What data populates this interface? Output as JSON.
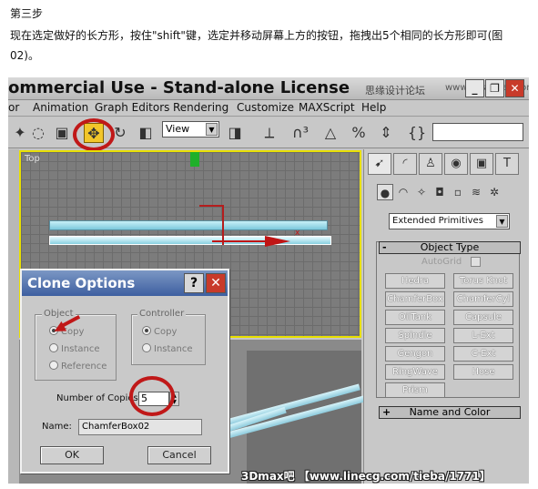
{
  "tutorial": {
    "step": "第三步",
    "description": "现在选定做好的长方形，按住\"shift\"键，选定并移动屏幕上方的按钮，拖拽出5个相同的长方形即可(图02)。"
  },
  "window": {
    "title": "ommercial Use - Stand-alone License",
    "watermark": "思缘设计论坛",
    "watermark_url": "www.missyuan.com",
    "minimize": "_",
    "maximize": "❐",
    "close": "✕"
  },
  "menu": [
    "or",
    "Animation",
    "Graph Editors",
    "Rendering",
    "Customize",
    "MAXScript",
    "Help"
  ],
  "toolbar": {
    "view_select": "View"
  },
  "viewport": {
    "label": "Top"
  },
  "command_panel": {
    "primitive_type": "Extended Primitives",
    "object_type_header": "Object Type",
    "autogrid_label": "AutoGrid",
    "buttons": [
      "Hedra",
      "Torus Knot",
      "ChamferBox",
      "ChamferCyl",
      "OilTank",
      "Capsule",
      "Spindle",
      "L-Ext",
      "Gengon",
      "C-Ext",
      "RingWave",
      "Hose",
      "Prism"
    ],
    "name_color_header": "Name and Color",
    "object_type_sign": "-",
    "name_color_sign": "+"
  },
  "clone_dialog": {
    "title": "Clone Options",
    "help": "?",
    "close": "✕",
    "object_group": "Object",
    "object_options": [
      "Copy",
      "Instance",
      "Reference"
    ],
    "object_selected": "Copy",
    "controller_group": "Controller",
    "controller_options": [
      "Copy",
      "Instance"
    ],
    "controller_selected": "Copy",
    "copies_label": "Number of Copies:",
    "copies_value": "5",
    "name_label": "Name:",
    "name_value": "ChamferBox02",
    "ok": "OK",
    "cancel": "Cancel"
  },
  "footer_watermark": "3Dmax吧 【www.linecg.com/tieba/1771】",
  "accent_colors": {
    "highlight_circle": "#c01818",
    "viewport_border": "#e8e000",
    "dialog_title": "#3e5fa0"
  }
}
